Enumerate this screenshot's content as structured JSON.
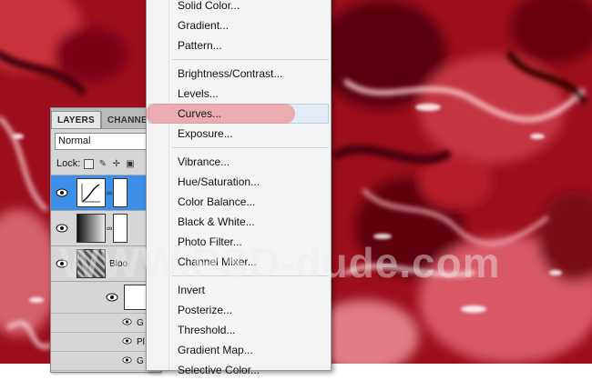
{
  "layers_panel": {
    "tabs": [
      {
        "label": "LAYERS"
      },
      {
        "label": "CHANNEL"
      }
    ],
    "blend_mode": "Normal",
    "lock_label": "Lock:",
    "layers": [
      {
        "name": "",
        "selected": true
      },
      {
        "name": "",
        "selected": false
      },
      {
        "name": "Bloo",
        "selected": false
      }
    ],
    "sub_items": [
      {
        "label": "G"
      },
      {
        "label": "Pl"
      },
      {
        "label": "G"
      }
    ]
  },
  "menu": {
    "items": [
      {
        "label": "Solid Color...",
        "group": 0
      },
      {
        "label": "Gradient...",
        "group": 0
      },
      {
        "label": "Pattern...",
        "group": 0
      },
      {
        "label": "Brightness/Contrast...",
        "group": 1
      },
      {
        "label": "Levels...",
        "group": 1
      },
      {
        "label": "Curves...",
        "group": 1,
        "hovered": true
      },
      {
        "label": "Exposure...",
        "group": 1
      },
      {
        "label": "Vibrance...",
        "group": 2
      },
      {
        "label": "Hue/Saturation...",
        "group": 2
      },
      {
        "label": "Color Balance...",
        "group": 2
      },
      {
        "label": "Black & White...",
        "group": 2
      },
      {
        "label": "Photo Filter...",
        "group": 2
      },
      {
        "label": "Channel Mixer...",
        "group": 2
      },
      {
        "label": "Invert",
        "group": 3
      },
      {
        "label": "Posterize...",
        "group": 3
      },
      {
        "label": "Threshold...",
        "group": 3
      },
      {
        "label": "Gradient Map...",
        "group": 3
      },
      {
        "label": "Selective Color...",
        "group": 3
      }
    ]
  },
  "watermark": "WWW.PSD-dude.com",
  "colors": {
    "background_red": "#a8101e",
    "selection_blue": "#3d8ee8",
    "highlight": "#f07878"
  }
}
